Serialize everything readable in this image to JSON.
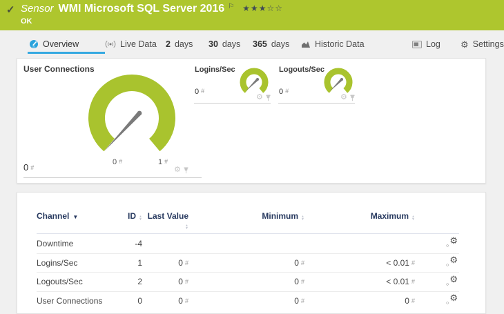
{
  "colors": {
    "brand_green": "#aec62e",
    "accent_blue": "#36a9e1",
    "gauge_green": "#a9c32e",
    "needle_gray": "#7a7a7a",
    "table_header_navy": "#27395f"
  },
  "icons": {
    "check": "✓",
    "flag": "⚐",
    "gear": "⚙",
    "sort_up": "▲",
    "sort_down": "▼",
    "small_gear_ring": "○"
  },
  "header": {
    "kind": "Sensor",
    "title": "WMI Microsoft SQL Server 2016",
    "stars": "★★★☆☆",
    "status": "OK"
  },
  "tabs": {
    "overview": "Overview",
    "live_data": "Live Data",
    "d2_num": "2",
    "d2_word": "days",
    "d30_num": "30",
    "d30_word": "days",
    "d365_num": "365",
    "d365_word": "days",
    "historic": "Historic Data",
    "log": "Log",
    "settings": "Settings"
  },
  "gauges": {
    "main": {
      "title": "User Connections",
      "value": "0",
      "unit": "#",
      "min": "0",
      "min_unit": "#",
      "max": "1",
      "max_unit": "#"
    },
    "logins": {
      "title": "Logins/Sec",
      "value": "0",
      "unit": "#"
    },
    "logouts": {
      "title": "Logouts/Sec",
      "value": "0",
      "unit": "#"
    }
  },
  "table": {
    "col_channel": "Channel",
    "col_id": "ID",
    "col_last": "Last Value",
    "col_min": "Minimum",
    "col_max": "Maximum",
    "rows": [
      {
        "channel": "Downtime",
        "id": "-4",
        "last": "",
        "last_unit": "",
        "min": "",
        "min_unit": "",
        "max": "",
        "max_unit": ""
      },
      {
        "channel": "Logins/Sec",
        "id": "1",
        "last": "0",
        "last_unit": "#",
        "min": "0",
        "min_unit": "#",
        "max": "< 0.01",
        "max_unit": "#"
      },
      {
        "channel": "Logouts/Sec",
        "id": "2",
        "last": "0",
        "last_unit": "#",
        "min": "0",
        "min_unit": "#",
        "max": "< 0.01",
        "max_unit": "#"
      },
      {
        "channel": "User Connections",
        "id": "0",
        "last": "0",
        "last_unit": "#",
        "min": "0",
        "min_unit": "#",
        "max": "0",
        "max_unit": "#"
      }
    ]
  }
}
